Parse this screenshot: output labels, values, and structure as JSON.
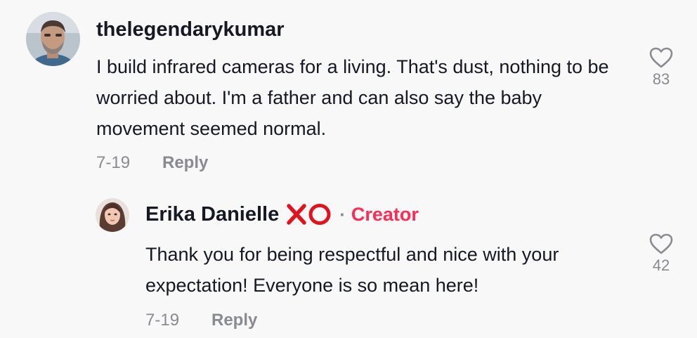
{
  "comments": [
    {
      "username": "thelegendarykumar",
      "text": "I build infrared cameras for a living. That's dust, nothing to be worried about. I'm a father and can also say the baby movement seemed normal.",
      "date": "7-19",
      "reply_label": "Reply",
      "like_count": "83",
      "avatar_icon": "avatar-man-beard"
    },
    {
      "username": "Erika Danielle",
      "emoji": "XO",
      "separator": "·",
      "badge": "Creator",
      "text": "Thank you for being respectful and nice with your expectation! Everyone is so mean here!",
      "date": "7-19",
      "reply_label": "Reply",
      "like_count": "42",
      "avatar_icon": "avatar-woman"
    }
  ],
  "colors": {
    "background": "#f8f8f8",
    "text": "#161823",
    "muted": "#8a8b91",
    "creator": "#fe2c55",
    "xo_red": "#e0141e"
  }
}
